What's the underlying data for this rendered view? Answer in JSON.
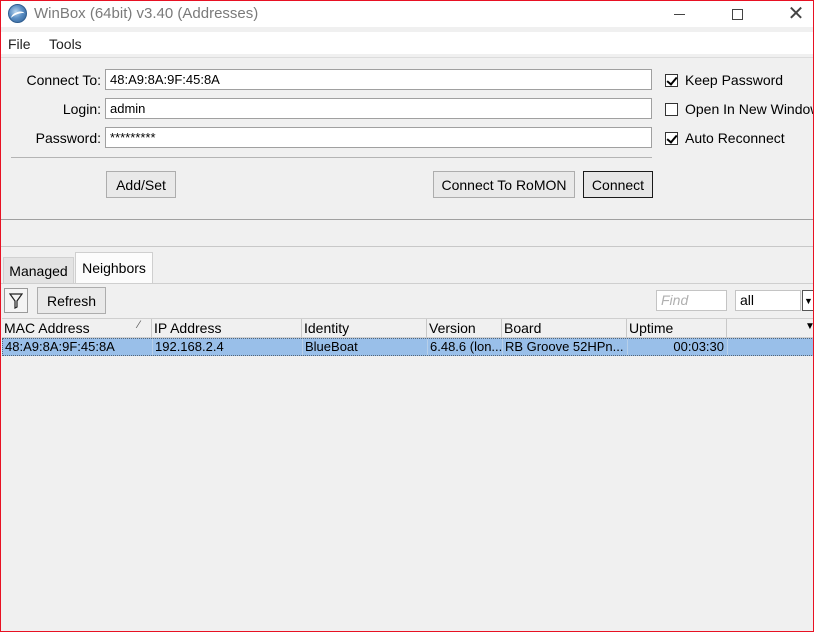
{
  "window": {
    "title": "WinBox (64bit) v3.40 (Addresses)",
    "close_glyph": "✕"
  },
  "menu": {
    "file": "File",
    "tools": "Tools"
  },
  "login_form": {
    "connect_to_label": "Connect To:",
    "connect_to_value": "48:A9:8A:9F:45:8A",
    "login_label": "Login:",
    "login_value": "admin",
    "password_label": "Password:",
    "password_value": "*********",
    "keep_password": {
      "label": "Keep Password",
      "checked": true
    },
    "open_in_new_window": {
      "label": "Open In New Window",
      "checked": false
    },
    "auto_reconnect": {
      "label": "Auto Reconnect",
      "checked": true
    },
    "add_set_button": "Add/Set",
    "connect_romon_button": "Connect To RoMON",
    "connect_button": "Connect"
  },
  "tabs": {
    "managed": "Managed",
    "neighbors": "Neighbors",
    "active": "Neighbors"
  },
  "toolbar": {
    "refresh_button": "Refresh",
    "find_placeholder": "Find",
    "filter_value": "all",
    "filter_icon": "filter-icon"
  },
  "table": {
    "columns": [
      "MAC Address",
      "IP Address",
      "Identity",
      "Version",
      "Board",
      "Uptime",
      ""
    ],
    "rows": [
      {
        "mac": "48:A9:8A:9F:45:8A",
        "ip": "192.168.2.4",
        "identity": "BlueBoat",
        "version": "6.48.6 (lon...",
        "board": "RB Groove 52HPn...",
        "uptime": "00:03:30",
        "selected": true
      }
    ]
  },
  "colors": {
    "selected_row": "#99bfe9",
    "window_border": "#e81123"
  }
}
